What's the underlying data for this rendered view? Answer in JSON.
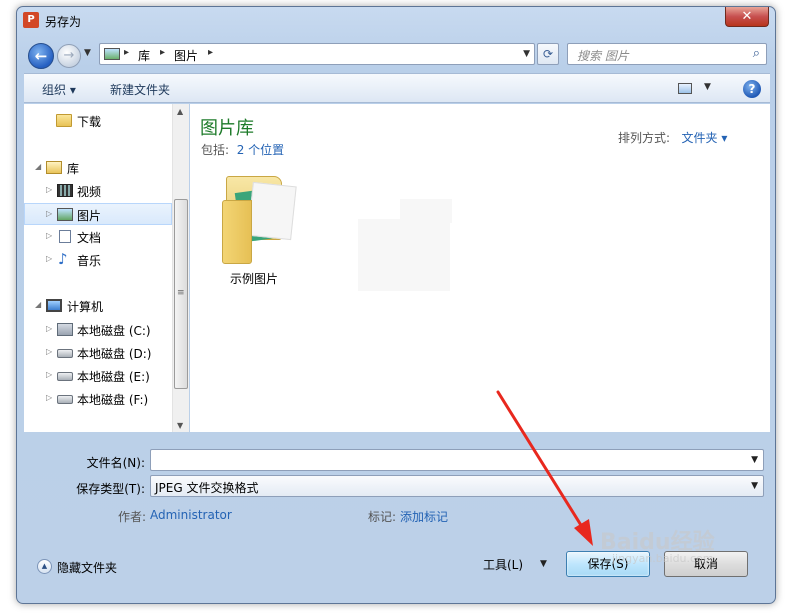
{
  "window": {
    "title": "另存为",
    "app_icon": "P",
    "close_glyph": "✕"
  },
  "address_bar": {
    "crumbs": [
      "库",
      "图片"
    ],
    "search_placeholder": "搜索 图片"
  },
  "toolbar": {
    "organize_label": "组织 ▾",
    "new_folder_label": "新建文件夹",
    "help_glyph": "?"
  },
  "nav": {
    "items": [
      {
        "label": "下载",
        "icon": "downloads-folder-icon"
      },
      {
        "label": "库",
        "icon": "library-icon"
      },
      {
        "label": "视频",
        "icon": "videos-icon"
      },
      {
        "label": "图片",
        "icon": "pictures-icon",
        "selected": true
      },
      {
        "label": "文档",
        "icon": "documents-icon"
      },
      {
        "label": "音乐",
        "icon": "music-icon"
      },
      {
        "label": "计算机",
        "icon": "computer-icon"
      },
      {
        "label": "本地磁盘 (C:)",
        "icon": "system-drive-icon"
      },
      {
        "label": "本地磁盘 (D:)",
        "icon": "drive-icon"
      },
      {
        "label": "本地磁盘 (E:)",
        "icon": "drive-icon"
      },
      {
        "label": "本地磁盘 (F:)",
        "icon": "drive-icon"
      }
    ]
  },
  "content": {
    "library_title": "图片库",
    "includes_label": "包括:",
    "includes_link": "2 个位置",
    "arrange_label": "排列方式:",
    "arrange_value": "文件夹 ▾",
    "folders": [
      {
        "label": "示例图片",
        "icon": "sample-pictures-folder-icon"
      }
    ]
  },
  "form": {
    "filename_label": "文件名(N):",
    "filename_value": "",
    "filetype_label": "保存类型(T):",
    "filetype_value": "JPEG 文件交换格式",
    "author_label": "作者:",
    "author_value": "Administrator",
    "tags_label": "标记:",
    "tags_value": "添加标记"
  },
  "footer": {
    "hide_folders_label": "隐藏文件夹",
    "tools_label": "工具(L)",
    "save_label": "保存(S)",
    "cancel_label": "取消"
  },
  "watermark": {
    "text": "Baidu经验",
    "sub": "jingyan.baidu.com"
  },
  "colors": {
    "library_title": "#1e7b2a",
    "link": "#2463b4",
    "annotation_arrow": "#e8281e"
  }
}
